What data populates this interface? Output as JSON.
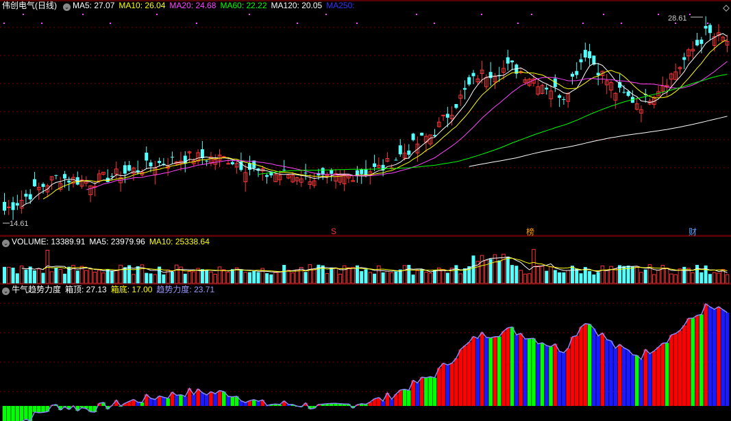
{
  "colors": {
    "up": "#ff3232",
    "down": "#54ffff",
    "grid": "#7a0000",
    "ma5": "#ffffff",
    "ma10": "#ffff00",
    "ma20": "#ff44ff",
    "ma60": "#00ff00",
    "ma120": "#ffffff",
    "ma250": "#3333ff",
    "label": "#cccccc",
    "volma5": "#ffffff",
    "volma10": "#ffff00",
    "bear": "#1a1aff",
    "bull": "#ff0000",
    "flat": "#00ff00",
    "base": "#8888ff"
  },
  "main": {
    "title": "伟创电气(日线)",
    "ma": [
      {
        "label": "MA5: 27.07",
        "color": "#ffffff"
      },
      {
        "label": "MA10: 26.04",
        "color": "#ffff00"
      },
      {
        "label": "MA20: 24.68",
        "color": "#ff44ff"
      },
      {
        "label": "MA60: 22.22",
        "color": "#00ff00"
      },
      {
        "label": "MA120: 20.05",
        "color": "#ffffff"
      },
      {
        "label": "MA250:",
        "color": "#3333ff"
      }
    ],
    "high_label": "28.61",
    "low_label": "14.61",
    "markers": [
      {
        "text": "S",
        "color": "#ff3232"
      },
      {
        "text": "榜",
        "color": "#ff9900"
      },
      {
        "text": "财",
        "color": "#5aa0ff"
      }
    ]
  },
  "volume": {
    "items": [
      {
        "label": "VOLUME: 13389.91",
        "color": "#ffffff"
      },
      {
        "label": "MA5: 23979.96",
        "color": "#ffffff"
      },
      {
        "label": "MA10: 25338.64",
        "color": "#ffff00"
      }
    ]
  },
  "indicator": {
    "name": "牛气趋势力度",
    "items": [
      {
        "label": "箱顶: 27.13",
        "color": "#ffffff"
      },
      {
        "label": "箱底: 17.00",
        "color": "#ffff00"
      },
      {
        "label": "趋势力度: 23.71",
        "color": "#9999ff"
      }
    ]
  },
  "chart_data": {
    "type": "candlestick",
    "price_range": [
      14.61,
      28.61
    ],
    "anchors": [
      [
        0,
        15.3
      ],
      [
        12,
        17.6
      ],
      [
        20,
        17.3
      ],
      [
        35,
        18.5
      ],
      [
        43,
        19.0
      ],
      [
        52,
        18.9
      ],
      [
        60,
        17.8
      ],
      [
        68,
        17.8
      ],
      [
        75,
        17.4
      ],
      [
        88,
        18.3
      ],
      [
        100,
        20.8
      ],
      [
        110,
        24.7
      ],
      [
        118,
        25.3
      ],
      [
        130,
        23.3
      ],
      [
        135,
        26.3
      ],
      [
        142,
        23.6
      ],
      [
        148,
        22.7
      ],
      [
        156,
        25.0
      ],
      [
        163,
        27.6
      ],
      [
        168,
        27.1
      ]
    ],
    "volume_range": [
      0,
      50000
    ],
    "indicator_range": [
      -5,
      40
    ]
  }
}
